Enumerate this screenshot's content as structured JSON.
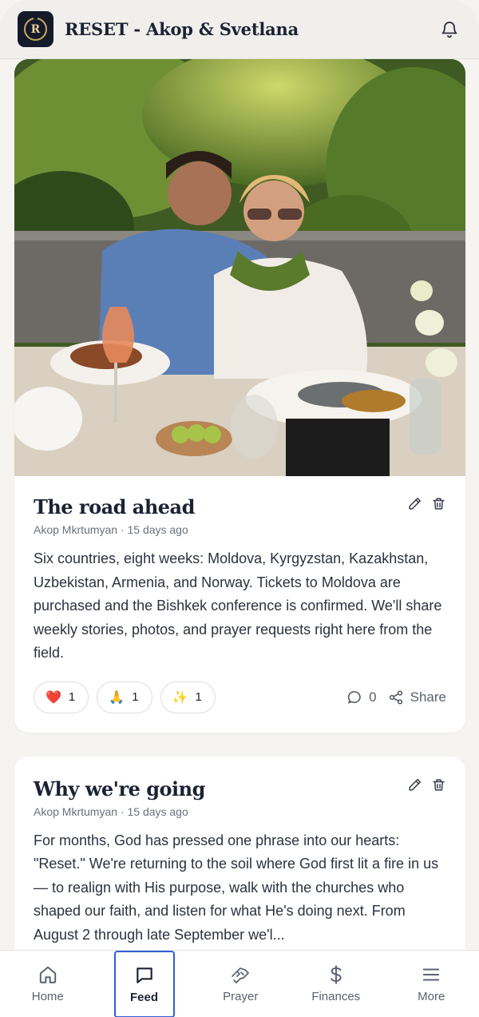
{
  "header": {
    "logo_letter": "R",
    "title": "RESET - Akop & Svetlana",
    "notifications_icon": "bell-icon"
  },
  "posts": [
    {
      "title": "The road ahead",
      "author": "Akop Mkrtumyan",
      "time": "15 days ago",
      "meta": "Akop Mkrtumyan · 15 days ago",
      "text": "Six countries, eight weeks: Moldova, Kyrgyzstan, Kazakhstan, Uzbekistan, Armenia, and Norway. Tickets to Moldova are purchased and the Bishkek conference is confirmed. We'll share weekly stories, photos, and prayer requests right here from the field.",
      "reactions": [
        {
          "emoji": "❤️",
          "count": "1"
        },
        {
          "emoji": "🙏",
          "count": "1"
        },
        {
          "emoji": "✨",
          "count": "1"
        }
      ],
      "comments_count": "0",
      "share_label": "Share"
    },
    {
      "title": "Why we're going",
      "author": "Akop Mkrtumyan",
      "time": "15 days ago",
      "meta": "Akop Mkrtumyan · 15 days ago",
      "text": "For months, God has pressed one phrase into our hearts: \"Reset.\" We're returning to the soil where God first lit a fire in us — to realign with His purpose, walk with the churches who shaped our faith, and listen for what He's doing next. From August 2 through late September we'l..."
    }
  ],
  "nav": {
    "items": [
      {
        "label": "Home",
        "icon": "home-icon"
      },
      {
        "label": "Feed",
        "icon": "message-square-icon"
      },
      {
        "label": "Prayer",
        "icon": "praying-hands-icon"
      },
      {
        "label": "Finances",
        "icon": "dollar-icon"
      },
      {
        "label": "More",
        "icon": "menu-icon"
      }
    ],
    "active": "Feed"
  },
  "colors": {
    "background": "#f5f4f1",
    "brand_navy": "#141a2a",
    "brand_gold": "#c9a85c",
    "active_outline": "#2f5fd8"
  }
}
